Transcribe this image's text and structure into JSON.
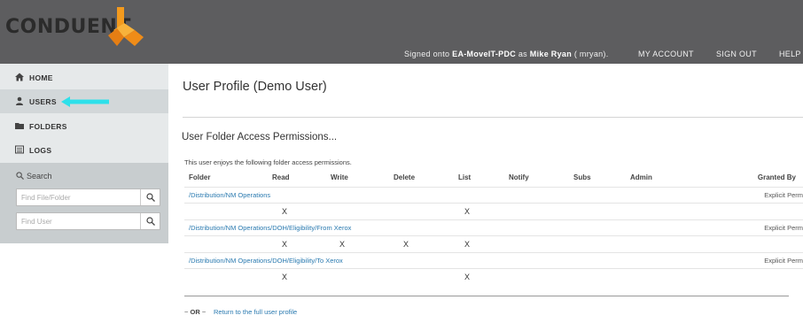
{
  "brand": {
    "logo_text": "CONDUENT",
    "logo_icon": "conduent-logo-mark"
  },
  "topnav": {
    "signed_prefix": "Signed onto",
    "server": "EA-MoveIT-PDC",
    "signed_as": "as",
    "user": "Mike Ryan",
    "username": "( mryan).",
    "my_account": "MY ACCOUNT",
    "sign_out": "SIGN OUT",
    "help": "HELP"
  },
  "sidebar": {
    "items": [
      {
        "label": "HOME",
        "icon": "home-icon"
      },
      {
        "label": "USERS",
        "icon": "user-icon"
      },
      {
        "label": "FOLDERS",
        "icon": "folder-icon"
      },
      {
        "label": "LOGS",
        "icon": "logs-icon"
      }
    ],
    "search": {
      "title": "Search",
      "file_placeholder": "Find File/Folder",
      "user_placeholder": "Find User"
    }
  },
  "main": {
    "title": "User Profile (Demo User)",
    "section_title": "User Folder Access Permissions...",
    "intro": "This user enjoys the following folder access permissions.",
    "columns": [
      "Folder",
      "Read",
      "Write",
      "Delete",
      "List",
      "Notify",
      "Subs",
      "Admin",
      "Granted By"
    ],
    "rows": [
      {
        "folder": "/Distribution/NM Operations",
        "granted_by": "Explicit Perm",
        "read": "X",
        "write": "",
        "delete": "",
        "list": "X"
      },
      {
        "folder": "/Distribution/NM Operations/DOH/Eligibility/From Xerox",
        "granted_by": "Explicit Perm",
        "read": "X",
        "write": "X",
        "delete": "X",
        "list": "X"
      },
      {
        "folder": "/Distribution/NM Operations/DOH/Eligibility/To Xerox",
        "granted_by": "Explicit Perm",
        "read": "X",
        "write": "",
        "delete": "",
        "list": "X"
      }
    ],
    "footer": {
      "or_prefix": "~",
      "or_word": "OR",
      "or_suffix": "~",
      "link": "Return to the full user profile"
    }
  },
  "colors": {
    "header_bg": "#5d5d5f",
    "sidebar_bg": "#e6e9ea",
    "accent_arrow": "#2ee0ea",
    "logo_orange": "#f39a1d",
    "link": "#2a7ab0"
  }
}
